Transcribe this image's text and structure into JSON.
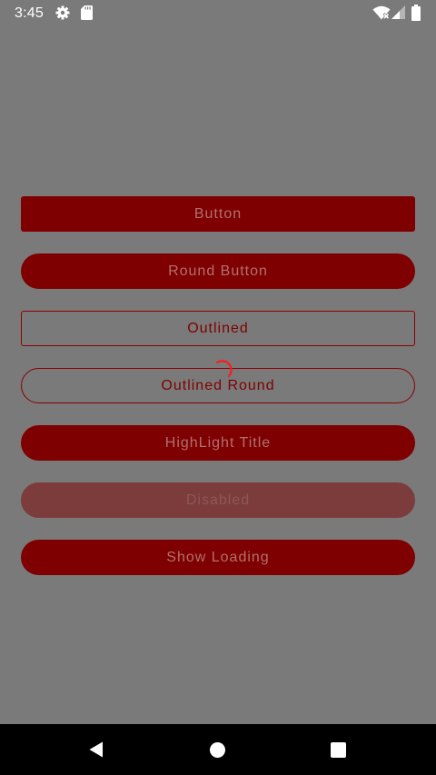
{
  "status_bar": {
    "time": "3:45",
    "icons": [
      "gear-icon",
      "sd-card-icon",
      "wifi-icon",
      "cell-signal-icon",
      "battery-icon"
    ]
  },
  "buttons": {
    "button": "Button",
    "round_button": "Round Button",
    "outlined": "Outlined",
    "outlined_round": "Outlined Round",
    "highlight_title": "HighLight Title",
    "disabled": "Disabled",
    "show_loading": "Show Loading"
  },
  "colors": {
    "background": "#7a7a7a",
    "button_fill": "#7f0000",
    "button_text": "#b07070",
    "disabled_fill": "#7c3c3c",
    "loading_spinner": "#ff1a1a",
    "nav_bar": "#000000"
  },
  "nav_bar": {
    "icons": [
      "back-icon",
      "home-icon",
      "recents-icon"
    ]
  }
}
